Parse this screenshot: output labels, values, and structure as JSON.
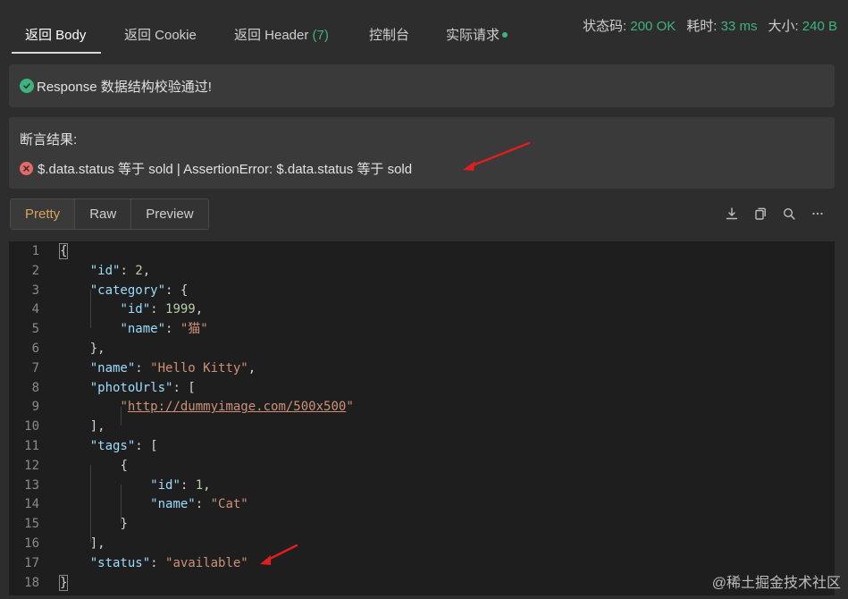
{
  "tabs": [
    {
      "label": "返回 Body",
      "active": true
    },
    {
      "label": "返回 Cookie"
    },
    {
      "label": "返回 Header",
      "count": "(7)"
    },
    {
      "label": "控制台"
    },
    {
      "label": "实际请求"
    }
  ],
  "stats": {
    "status_label": "状态码:",
    "status_value": "200 OK",
    "time_label": "耗时:",
    "time_value": "33 ms",
    "size_label": "大小:",
    "size_value": "240 B"
  },
  "schema": {
    "message": "Response 数据结构校验通过!"
  },
  "assertion": {
    "title": "断言结果:",
    "message": "$.data.status 等于 sold | AssertionError: $.data.status 等于 sold"
  },
  "view_tabs": [
    {
      "label": "Pretty",
      "active": true
    },
    {
      "label": "Raw"
    },
    {
      "label": "Preview"
    }
  ],
  "tool_icons": [
    "download-icon",
    "copy-icon",
    "search-icon",
    "more-icon"
  ],
  "code": {
    "line_numbers": [
      "1",
      "2",
      "3",
      "4",
      "5",
      "6",
      "7",
      "8",
      "9",
      "10",
      "11",
      "12",
      "13",
      "14",
      "15",
      "16",
      "17",
      "18"
    ],
    "tokens": {
      "id_key": "\"id\"",
      "id_val": "2",
      "category_key": "\"category\"",
      "cat_id_key": "\"id\"",
      "cat_id_val": "1999",
      "cat_name_key": "\"name\"",
      "cat_name_val": "\"猫\"",
      "name_key": "\"name\"",
      "name_val": "\"Hello Kitty\"",
      "photo_key": "\"photoUrls\"",
      "photo_val": "http://dummyimage.com/500x500",
      "tags_key": "\"tags\"",
      "tag_id_key": "\"id\"",
      "tag_id_val": "1",
      "tag_name_key": "\"name\"",
      "tag_name_val": "\"Cat\"",
      "status_key": "\"status\"",
      "status_val": "\"available\""
    }
  },
  "watermark": "@稀土掘金技术社区",
  "colors": {
    "accent_green": "#3fb37f",
    "error_red": "#e26a6a",
    "active_view": "#d9a25c",
    "arrow_red": "#e01e1e"
  }
}
